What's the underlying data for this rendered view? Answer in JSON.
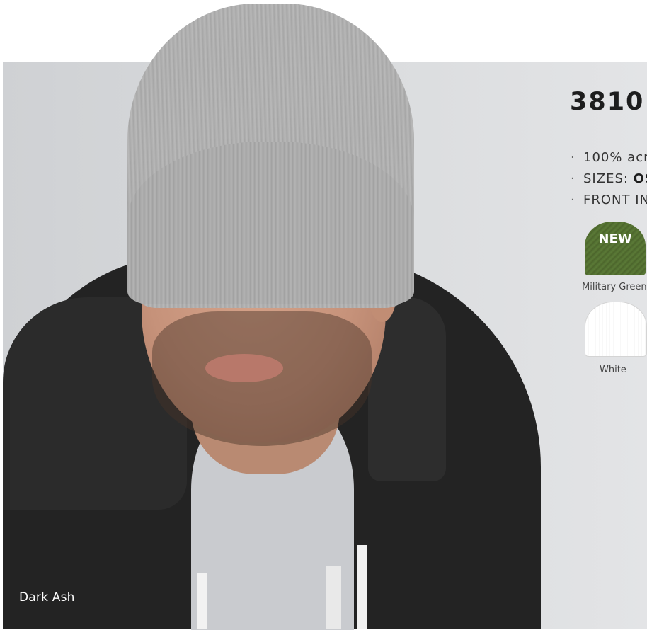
{
  "hero": {
    "color_caption": "Dark Ash"
  },
  "product": {
    "title": "3810 |",
    "features": [
      {
        "text": "100% acr",
        "bold": ""
      },
      {
        "text": "SIZES: ",
        "bold": "OS"
      },
      {
        "text": "FRONT IN",
        "bold": ""
      }
    ]
  },
  "swatches": [
    {
      "name": "Military Green",
      "badge": "NEW",
      "color": "#4e6a2f"
    },
    {
      "name": "White",
      "badge": "",
      "color": "#ffffff"
    }
  ]
}
